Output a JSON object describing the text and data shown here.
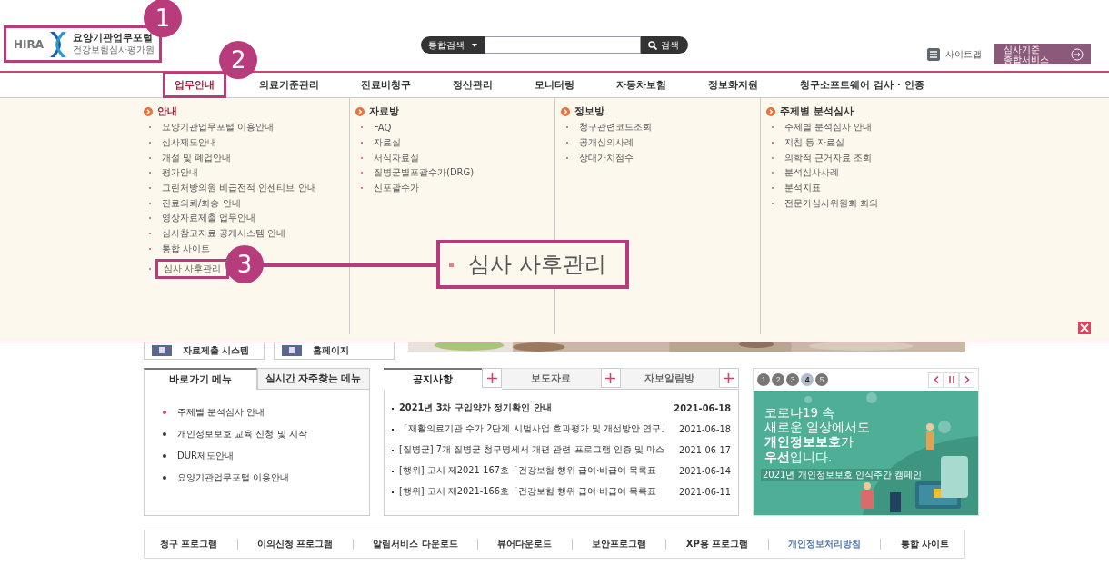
{
  "header": {
    "logo": {
      "brand": "HIRA",
      "title": "요양기관업무포털",
      "subtitle": "건강보험심사평가원",
      "boxed": true
    },
    "search": {
      "scope": "통합검색",
      "button": "검색"
    },
    "sitemap": "사이트맵",
    "service_button": [
      "심사기준",
      "종합서비스"
    ]
  },
  "annotations": [
    {
      "number": "1"
    },
    {
      "number": "2"
    },
    {
      "number": "3"
    }
  ],
  "nav": [
    {
      "label": "업무안내",
      "selected": true,
      "boxed": true
    },
    {
      "label": "의료기준관리",
      "selected": false,
      "boxed": false
    },
    {
      "label": "진료비청구",
      "selected": false,
      "boxed": false
    },
    {
      "label": "정산관리",
      "selected": false,
      "boxed": false
    },
    {
      "label": "모니터링",
      "selected": false,
      "boxed": false
    },
    {
      "label": "자동차보험",
      "selected": false,
      "boxed": false
    },
    {
      "label": "정보화지원",
      "selected": false,
      "boxed": false
    },
    {
      "label": "청구소프트웨어 검사 · 인증",
      "selected": false,
      "boxed": false
    }
  ],
  "menu": {
    "columns": [
      {
        "heading": "안내",
        "selected": true,
        "items": [
          {
            "label": "요양기관업무포털 이용안내",
            "boxed": false
          },
          {
            "label": "심사제도안내",
            "boxed": false
          },
          {
            "label": "개설 및 폐업안내",
            "boxed": false
          },
          {
            "label": "평가안내",
            "boxed": false
          },
          {
            "label": "그린처방의원 비급전적 인센티브 안내",
            "boxed": false
          },
          {
            "label": "진료의뢰/회송 안내",
            "boxed": false
          },
          {
            "label": "영상자료제출 업무안내",
            "boxed": false
          },
          {
            "label": "심사참고자료 공개시스템 안내",
            "boxed": false
          },
          {
            "label": "통합 사이트",
            "boxed": false
          },
          {
            "label": "심사 사후관리",
            "boxed": true
          }
        ]
      },
      {
        "heading": "자료방",
        "selected": false,
        "items": [
          {
            "label": "FAQ",
            "boxed": false
          },
          {
            "label": "자료실",
            "boxed": false
          },
          {
            "label": "서식자료실",
            "boxed": false
          },
          {
            "label": "질병군별포괄수가(DRG)",
            "boxed": false
          },
          {
            "label": "신포괄수가",
            "boxed": false
          }
        ]
      },
      {
        "heading": "정보방",
        "selected": false,
        "items": [
          {
            "label": "청구관련코드조회",
            "boxed": false
          },
          {
            "label": "공개심의사례",
            "boxed": false
          },
          {
            "label": "상대가치점수",
            "boxed": false
          }
        ]
      },
      {
        "heading": "주제별 분석심사",
        "selected": false,
        "items": [
          {
            "label": "주제별 분석심사 안내",
            "boxed": false
          },
          {
            "label": "지침 등 자료실",
            "boxed": false
          },
          {
            "label": "의학적 근거자료 조회",
            "boxed": false
          },
          {
            "label": "분석심사사례",
            "boxed": false
          },
          {
            "label": "분석지표",
            "boxed": false
          },
          {
            "label": "전문가심사위원회 회의",
            "boxed": false
          }
        ]
      }
    ]
  },
  "callout": "심사 사후관리",
  "shortcuts": [
    "자료제출 시스템",
    "홈페이지"
  ],
  "quick_tabs": [
    {
      "label": "바로가기 메뉴",
      "selected": true
    },
    {
      "label": "실시간 자주찾는 메뉴",
      "selected": false
    }
  ],
  "quick_links": [
    {
      "label": "주제별 분석심사 안내",
      "color": "#d4477a"
    },
    {
      "label": "개인정보보호 교육 신청 및 시작",
      "color": "#333333"
    },
    {
      "label": "DUR제도안내",
      "color": "#333333"
    },
    {
      "label": "요양기관업무포털 이용안내",
      "color": "#333333"
    }
  ],
  "news_tabs": [
    {
      "label": "공지사항",
      "selected": true
    },
    {
      "label": "보도자료",
      "selected": false
    },
    {
      "label": "자보알림방",
      "selected": false
    }
  ],
  "news": [
    {
      "title": "2021년 3차 구입약가 정기확인 안내",
      "date": "2021-06-18",
      "bold": true
    },
    {
      "title": "「재활의료기관 수가 2단계 시범사업 효과평가 및 개선방안 연구」",
      "date": "2021-06-18",
      "bold": false
    },
    {
      "title": "[질병군] 7개 질병군 청구명세서 개편 관련 프로그램 인증 및 마스",
      "date": "2021-06-17",
      "bold": false
    },
    {
      "title": "[행위] 고시 제2021-167호「건강보험 행위 급여·비급여 목록표",
      "date": "2021-06-14",
      "bold": false
    },
    {
      "title": "[행위] 고시 제2021-166호「건강보험 행위 급여·비급여 목록표",
      "date": "2021-06-11",
      "bold": false
    }
  ],
  "banner": {
    "pages": [
      {
        "label": "1",
        "selected": false
      },
      {
        "label": "2",
        "selected": false
      },
      {
        "label": "3",
        "selected": false
      },
      {
        "label": "4",
        "selected": true
      },
      {
        "label": "5",
        "selected": false
      }
    ],
    "lines": [
      "코로나19 속",
      "새로운 일상에서도",
      "**개인정보보호**가",
      "**우선**입니다."
    ],
    "caption": "2021년 개인정보보호 인식주간 캠페인"
  },
  "footer_links": [
    {
      "label": "청구 프로그램",
      "kind": "plain"
    },
    {
      "label": "이의신청 프로그램",
      "kind": "plain"
    },
    {
      "label": "알림서비스 다운로드",
      "kind": "plain"
    },
    {
      "label": "뷰어다운로드",
      "kind": "plain"
    },
    {
      "label": "보안프로그램",
      "kind": "plain"
    },
    {
      "label": "XP용 프로그램",
      "kind": "plain"
    },
    {
      "label": "개인정보처리방침",
      "kind": "policy"
    },
    {
      "label": "통합 사이트",
      "kind": "plain"
    }
  ]
}
